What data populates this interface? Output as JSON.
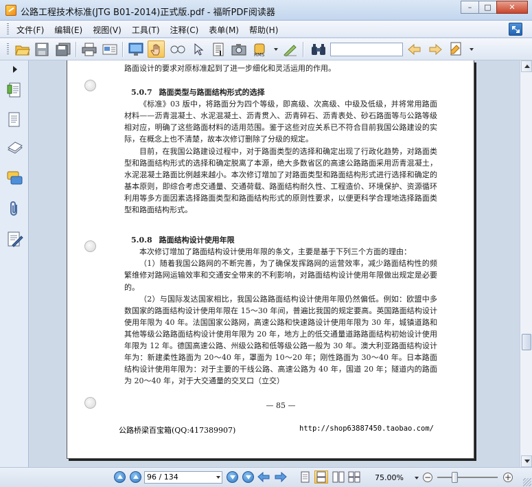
{
  "window": {
    "title": "公路工程技术标准(JTG B01-2014)正式版.pdf - 福昕PDF阅读器",
    "minimize": "–",
    "maximize": "□",
    "close": "✕"
  },
  "menu": [
    {
      "label": "文件(F)"
    },
    {
      "label": "编辑(E)"
    },
    {
      "label": "视图(V)"
    },
    {
      "label": "工具(T)"
    },
    {
      "label": "注释(C)"
    },
    {
      "label": "表单(M)"
    },
    {
      "label": "帮助(H)"
    }
  ],
  "toolbar": {
    "active_tool": "hand-tool",
    "search_value": "",
    "icons": [
      "open-icon",
      "save-icon",
      "save-all-icon",
      "print-icon",
      "email-icon",
      "fullscreen-icon",
      "hand-icon",
      "zoom-icon",
      "select-icon",
      "text-select-icon",
      "snapshot-icon",
      "rms-icon",
      "sign-icon",
      "find-icon",
      "prev-result-icon",
      "next-result-icon",
      "highlight-icon"
    ]
  },
  "document": {
    "intro_line": "路面设计的要求对原标准起到了进一步细化和灵活运用的作用。",
    "section1": {
      "number": "5.0.7",
      "title": "路面类型与路面结构形式的选择",
      "p1": "《标准》03 版中，将路面分为四个等级，即高级、次高级、中级及低级，并将常用路面材料——沥青混凝土、水泥混凝土、沥青贯入、沥青碎石、沥青表处、砂石路面等与公路等级相对应，明确了这些路面材料的适用范围。鉴于这些对应关系已不符合目前我国公路建设的实际，在概念上也不清楚，故本次修订删除了分级的规定。",
      "p2": "目前，在我国公路建设过程中，对于路面类型的选择和确定出现了行政化趋势，对路面类型和路面结构形式的选择和确定脱离了本源，绝大多数省区的高速公路路面采用沥青混凝土，水泥混凝土路面比例越来越小。本次修订增加了对路面类型和路面结构形式进行选择和确定的基本原则，即综合考虑交通量、交通荷载、路面结构耐久性、工程造价、环境保护、资源循环利用等多方面因素选择路面类型和路面结构形式的原则性要求，以便更科学合理地选择路面类型和路面结构形式。"
    },
    "section2": {
      "number": "5.0.8",
      "title": "路面结构设计使用年限",
      "p1": "本次修订增加了路面结构设计使用年限的条文，主要是基于下列三个方面的理由：",
      "p2": "（1）随着我国公路网的不断完善，为了确保发挥路网的运营效率，减少路面结构性的频繁维修对路网运输效率和交通安全带来的不利影响，对路面结构设计使用年限做出规定是必要的。",
      "p3": "（2）与国际发达国家相比，我国公路路面结构设计使用年限仍然偏低。例如：欧盟中多数国家的路面结构设计使用年限在 15～30 年间，普遍比我国的规定要高。英国路面结构设计使用年限为 40 年。法国国家公路网，高速公路和快速路设计使用年限为 30 年，城镇道路和其他等级公路路面结构设计使用年限为 20 年，地方上的低交通量道路路面结构初始设计使用年限为 12 年。德国高速公路、州级公路和低等级公路一般为 30 年。澳大利亚路面结构设计年为：新建柔性路面为 20～40 年，罩面为 10～20 年；刚性路面为 30～40 年。日本路面结构设计使用年限为：对于主要的干线公路、高速公路为 40 年，国道 20 年；隧道内的路面为 20～40 年，对于大交通量的交叉口（立交）"
    },
    "page_number": "— 85 —",
    "footer_left": "公路桥梁百宝箱(QQ:417389907)",
    "footer_right": "http://shop63887450.taobao.com/"
  },
  "statusbar": {
    "page_indicator": "96 / 134",
    "zoom": "75.00%",
    "zoom_fraction": 0.3
  }
}
